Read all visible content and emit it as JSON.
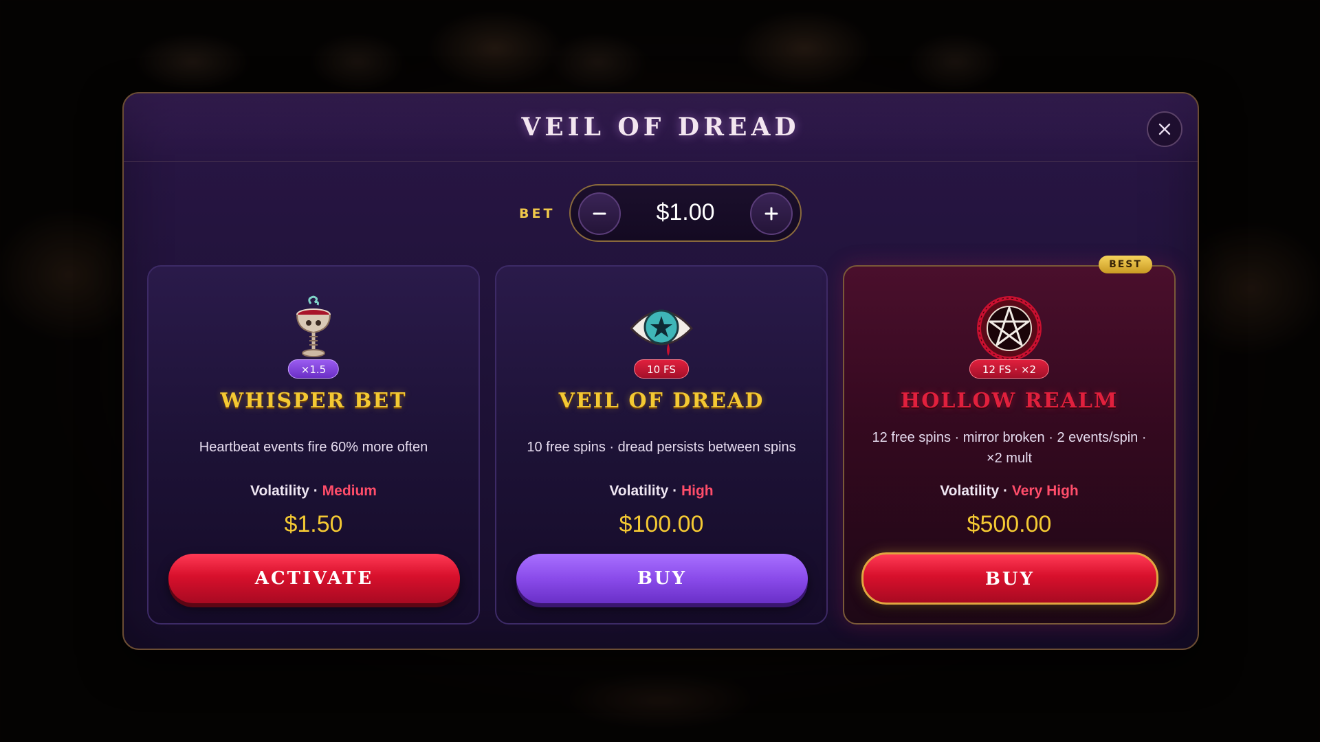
{
  "modal": {
    "title": "Veil of Dread",
    "close_icon": "close-icon"
  },
  "bet": {
    "label": "BET",
    "value": "$1.00",
    "minus_symbol": "−",
    "plus_symbol": "+"
  },
  "cards": [
    {
      "icon": "chalice-icon",
      "tag": "×1.5",
      "title": "Whisper Bet",
      "description": "Heartbeat events fire 60% more often",
      "volatility_label": "Volatility ·",
      "volatility_value": "Medium",
      "price": "$1.50",
      "button": "Activate"
    },
    {
      "icon": "eye-icon",
      "tag": "10 FS",
      "title": "Veil of Dread",
      "description": "10 free spins · dread persists between spins",
      "volatility_label": "Volatility ·",
      "volatility_value": "High",
      "price": "$100.00",
      "button": "Buy"
    },
    {
      "icon": "pentagram-icon",
      "badge": "BEST",
      "tag": "12 FS · ×2",
      "title": "Hollow Realm",
      "description": "12 free spins · mirror broken · 2 events/spin · ×2 mult",
      "volatility_label": "Volatility ·",
      "volatility_value": "Very High",
      "price": "$500.00",
      "button": "Buy"
    }
  ],
  "colors": {
    "gold": "#f4c933",
    "crimson": "#e0203d",
    "purple_button": "#8a4bea",
    "volatility_value": "#ff4d6a"
  }
}
